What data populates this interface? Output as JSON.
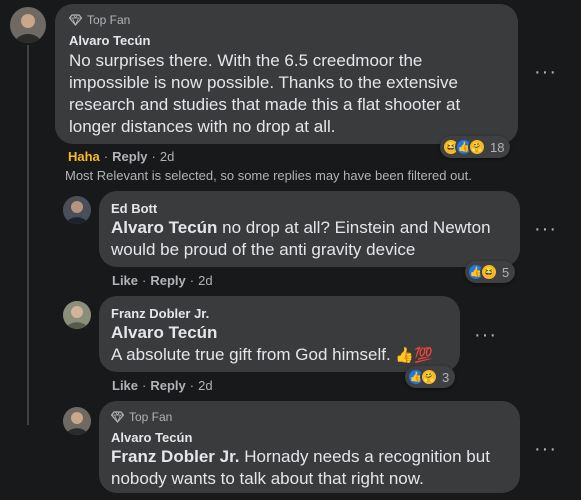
{
  "comment1": {
    "badge": "Top Fan",
    "author": "Alvaro Tecún",
    "text_lines": [
      "No surprises there. With the 6.5 creedmoor the",
      "impossible is now possible. Thanks to the extensive",
      "research and studies that made this a flat shooter at",
      "longer distances with no drop at all."
    ],
    "reaction_icons": [
      "haha",
      "like",
      "care"
    ],
    "reaction_count": "18",
    "action_reaction": "Haha",
    "action_reply": "Reply",
    "time": "2d"
  },
  "filter_notice": "Most Relevant is selected, so some replies may have been filtered out.",
  "reply1": {
    "author": "Ed Bott",
    "mention": "Alvaro Tecún",
    "text_line1_rest": " no drop at all? Einstein and Newton",
    "text_line2": "would be proud of the anti gravity device",
    "reaction_icons": [
      "like",
      "haha"
    ],
    "reaction_count": "5",
    "action_like": "Like",
    "action_reply": "Reply",
    "time": "2d"
  },
  "reply2": {
    "author": "Franz Dobler Jr.",
    "mention": "Alvaro Tecún",
    "text": "A absolute true gift from God himself. ",
    "emoji": "👍💯",
    "reaction_icons": [
      "like",
      "care"
    ],
    "reaction_count": "3",
    "action_like": "Like",
    "action_reply": "Reply",
    "time": "2d"
  },
  "reply3": {
    "badge": "Top Fan",
    "author": "Alvaro Tecún",
    "mention": "Franz Dobler Jr.",
    "text_line1_rest": " Hornady needs a recognition but",
    "text_line2": "nobody wants to talk about that right now."
  },
  "icons": {
    "diamond": "diamond-icon",
    "more": "more-options-icon"
  },
  "colors": {
    "background": "#18191a",
    "bubble": "#3a3b3c",
    "haha_action": "#f7b928",
    "like_blue": "#1877f2"
  }
}
